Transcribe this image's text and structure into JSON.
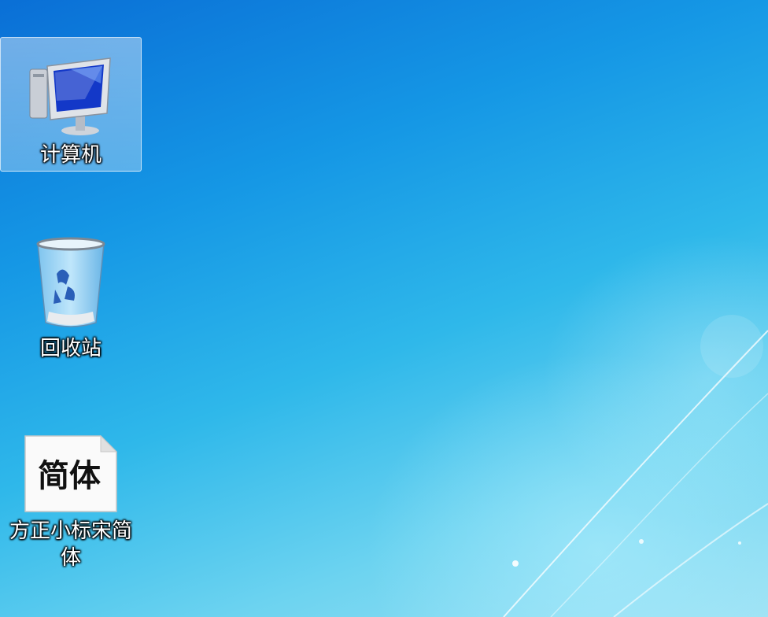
{
  "desktop": {
    "icons": [
      {
        "label": "计算机",
        "icon": "computer-icon",
        "selected": true
      },
      {
        "label": "回收站",
        "icon": "recycle-bin-icon",
        "selected": false
      },
      {
        "label": "方正小标宋简体",
        "icon": "font-file-icon",
        "preview_text": "简体",
        "selected": false
      }
    ]
  },
  "colors": {
    "wallpaper_top": "#0a6fd6",
    "wallpaper_bottom": "#9ee2f4",
    "label_text": "#ffffff"
  }
}
